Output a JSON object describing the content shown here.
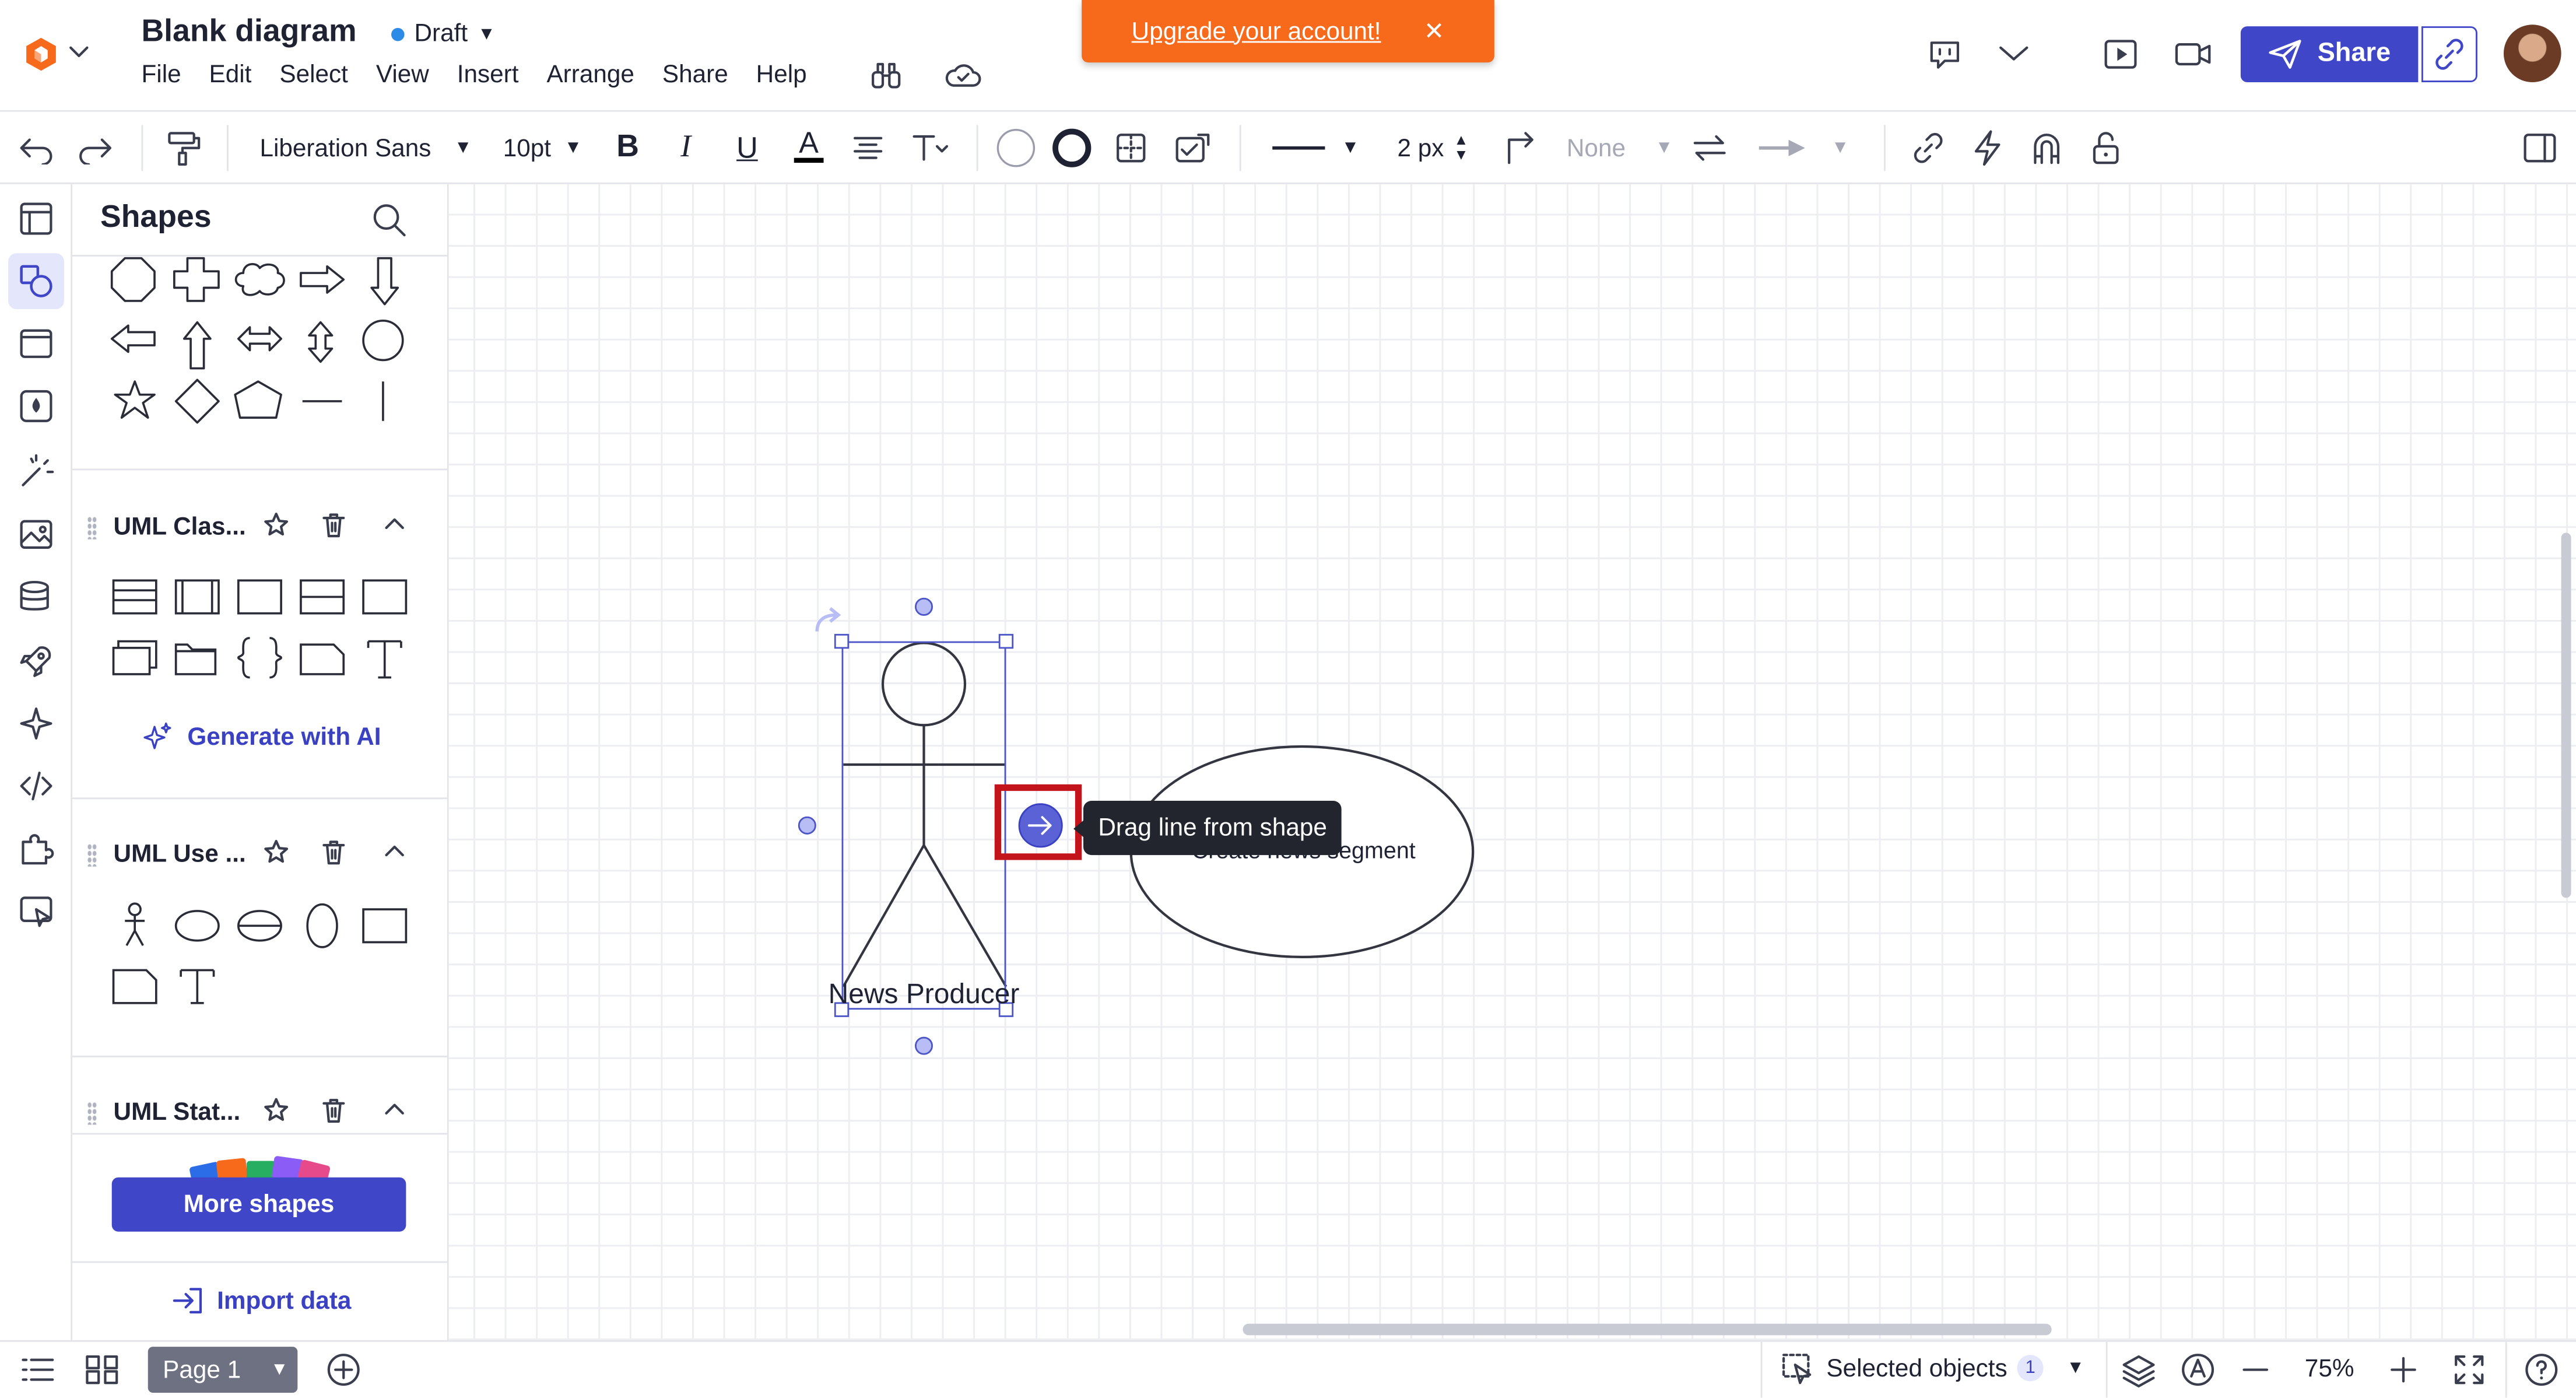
{
  "header": {
    "doc_title": "Blank diagram",
    "status": "Draft",
    "menu": [
      "File",
      "Edit",
      "Select",
      "View",
      "Insert",
      "Arrange",
      "Share",
      "Help"
    ],
    "upgrade_text": "Upgrade your account!",
    "share_label": "Share"
  },
  "toolbar": {
    "font_family": "Liberation Sans",
    "font_size": "10pt",
    "line_width": "2 px",
    "line_end": "None"
  },
  "panel": {
    "title": "Shapes",
    "sections": [
      {
        "name": "UML Clas..."
      },
      {
        "name": "UML Use ..."
      },
      {
        "name": "UML Stat..."
      }
    ],
    "generate_ai": "Generate with AI",
    "more_shapes": "More shapes",
    "import_data": "Import data"
  },
  "canvas": {
    "actor_label": "News Producer",
    "usecase_label": "Create news segment",
    "tooltip": "Drag line from shape"
  },
  "bottom": {
    "page_label": "Page 1",
    "selected_label": "Selected objects",
    "selected_count": "1",
    "zoom": "75%"
  },
  "colors": {
    "accent": "#4046c8",
    "upgrade_bg": "#f76a1c",
    "highlight": "#c4141b",
    "selection": "#4c55c7"
  }
}
